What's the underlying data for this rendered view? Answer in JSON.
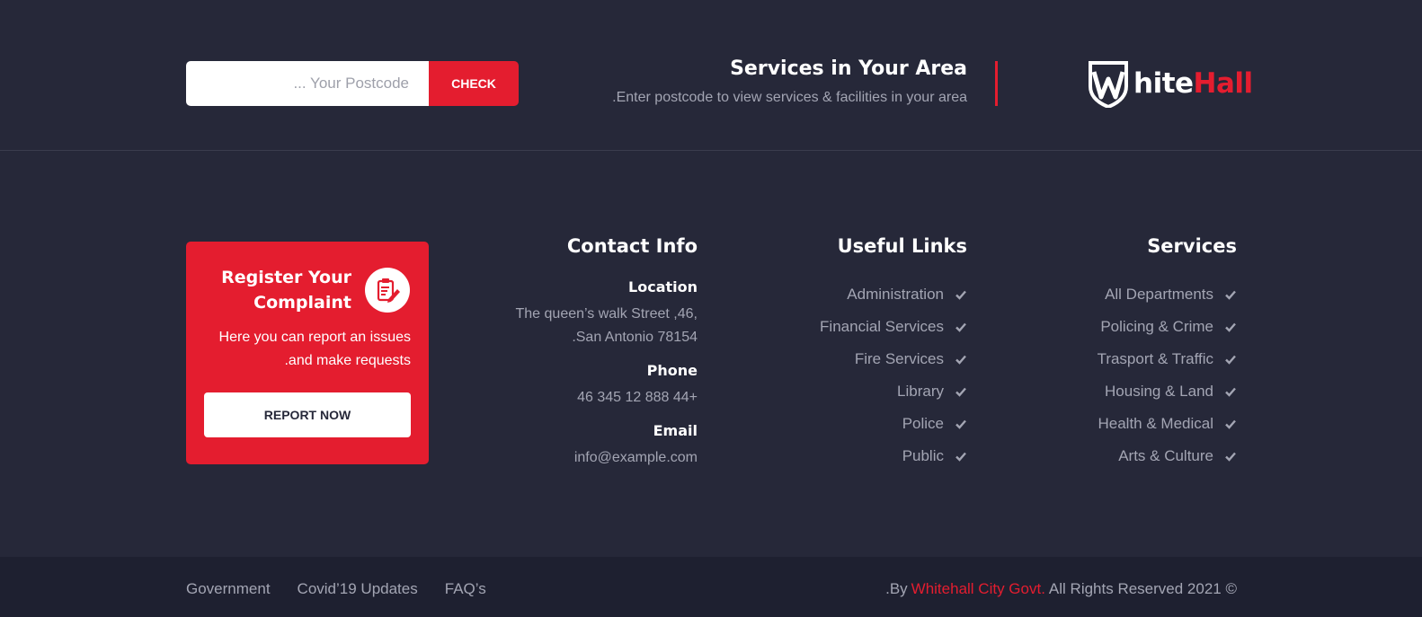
{
  "top": {
    "postcode_placeholder": "... Your Postcode",
    "check_label": "CHECK",
    "area_title": "Services in Your Area",
    "area_subtitle": ".Enter postcode to view services & facilities in your area",
    "logo": {
      "part1": "W",
      "part2": "hite",
      "part3": "Hall"
    }
  },
  "complaint": {
    "title": "Register Your Complaint",
    "text": "Here you can report an issues .and make requests",
    "button": "REPORT NOW",
    "icon": "clipboard-edit-icon"
  },
  "contact": {
    "title": "Contact Info",
    "location_label": "Location",
    "location_line1": "The queen’s walk Street ,46,",
    "location_line2": ".San Antonio 78154",
    "phone_label": "Phone",
    "phone": "46 345 12 888 44+",
    "email_label": "Email",
    "email": "info@example.com"
  },
  "useful_links": {
    "title": "Useful Links",
    "items": [
      "Administration",
      "Financial Services",
      "Fire Services",
      "Library",
      "Police",
      "Public"
    ]
  },
  "services": {
    "title": "Services",
    "items": [
      "All Departments",
      "Policing & Crime",
      "Trasport & Traffic",
      "Housing & Land",
      "Health & Medical",
      "Arts & Culture"
    ]
  },
  "bottom": {
    "nav": [
      "Government",
      "Covid’19 Updates",
      "FAQ’s"
    ],
    "copyright_prefix": ".By",
    "copyright_brand": "Whitehall City Govt.",
    "copyright_suffix": "All Rights Reserved 2021 ©"
  },
  "colors": {
    "accent": "#e41d2f",
    "background": "#262839",
    "bottom_bar": "#1e2030",
    "muted_text": "#a3a5b3"
  }
}
